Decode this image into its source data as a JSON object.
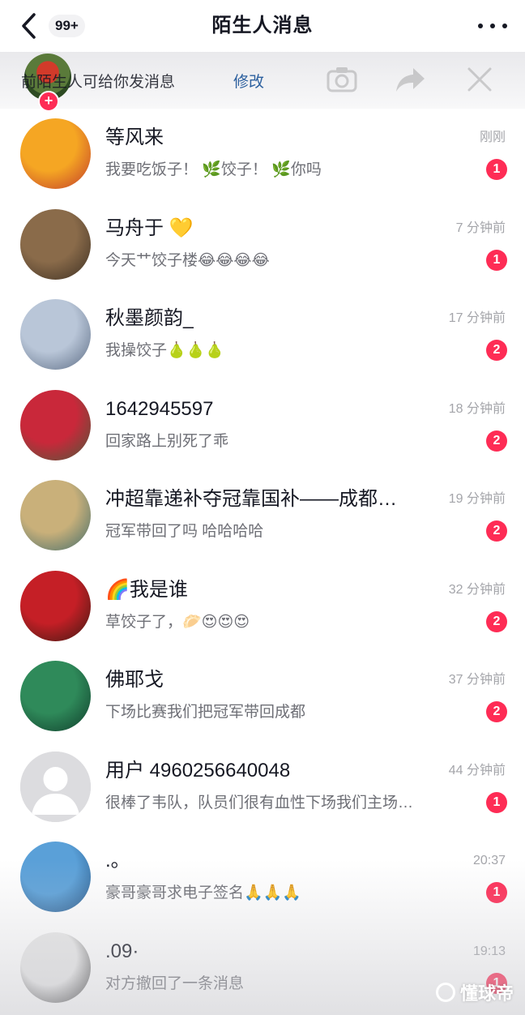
{
  "header": {
    "title": "陌生人消息",
    "badge": "99+",
    "back_icon": "chevron-left-icon",
    "more_icon": "more-dots-icon"
  },
  "banner": {
    "text": "前陌生人可给你发消息",
    "edit_label": "修改",
    "plus": "+"
  },
  "conversations": [
    {
      "name": "等风来",
      "preview": "我要吃饭子！ 🌿饺子！ 🌿你吗",
      "time": "刚刚",
      "unread": "1",
      "avatar_colors": [
        "#f5a623",
        "#c0392b"
      ]
    },
    {
      "name": "马舟于 💛",
      "preview": "今天艹饺子楼😂😂😂😂",
      "time": "7 分钟前",
      "unread": "1",
      "avatar_colors": [
        "#8a6b4a",
        "#3b2e22"
      ]
    },
    {
      "name": "秋墨颜韵_",
      "preview": "我操饺子🍐🍐🍐",
      "time": "17 分钟前",
      "unread": "2",
      "avatar_colors": [
        "#b9c6d8",
        "#5a6a82"
      ]
    },
    {
      "name": "1642945597",
      "preview": "回家路上别死了乖",
      "time": "18 分钟前",
      "unread": "2",
      "avatar_colors": [
        "#c9283a",
        "#4a5a3a"
      ]
    },
    {
      "name": "冲超靠递补夺冠靠国补——成都…",
      "preview": "冠军带回了吗 哈哈哈哈",
      "time": "19 分钟前",
      "unread": "2",
      "avatar_colors": [
        "#c9b07a",
        "#3f6b6b"
      ]
    },
    {
      "name": "🌈我是谁",
      "preview": "草饺子了，🥟😍😍😍",
      "time": "32 分钟前",
      "unread": "2",
      "avatar_colors": [
        "#c51f26",
        "#3a1a12"
      ]
    },
    {
      "name": "佛耶戈",
      "preview": "下场比赛我们把冠军带回成都",
      "time": "37 分钟前",
      "unread": "2",
      "avatar_colors": [
        "#2f8a5a",
        "#0f3b2a"
      ]
    },
    {
      "name": "用户 4960256640048",
      "preview": "很棒了韦队，队员们很有血性下场我们主场…",
      "time": "44 分钟前",
      "unread": "1",
      "avatar_colors": [
        "#d8d8db",
        "#c9c9cc"
      ]
    },
    {
      "name": ".。",
      "preview": "豪哥豪哥求电子签名🙏🙏🙏",
      "time": "20:37",
      "unread": "1",
      "avatar_colors": [
        "#5aa0d8",
        "#1f4f80"
      ]
    },
    {
      "name": ".09·",
      "preview": "对方撤回了一条消息",
      "time": "19:13",
      "unread": "1",
      "avatar_colors": [
        "#e8e8e8",
        "#222222"
      ]
    }
  ],
  "watermark": "懂球帝"
}
